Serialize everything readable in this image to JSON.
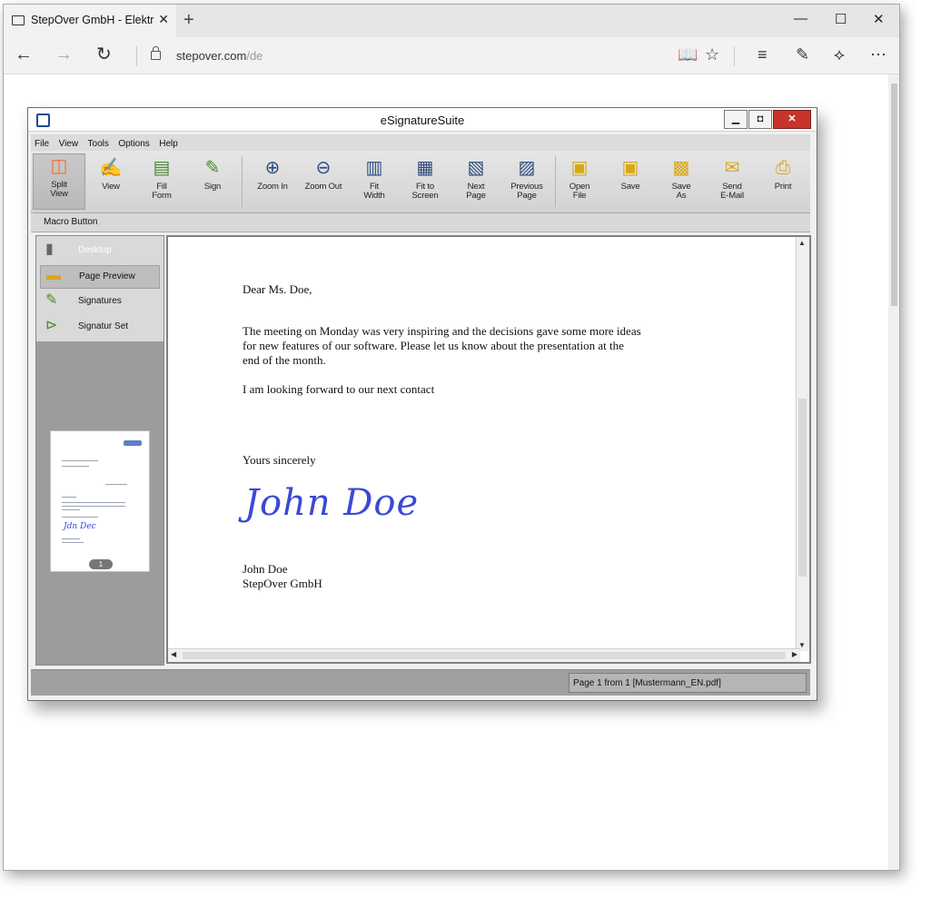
{
  "browser": {
    "tab_title": "StepOver GmbH - Elektr",
    "url_domain": "stepover.com",
    "url_path": "/de",
    "new_tab_symbol": "+"
  },
  "app": {
    "title": "eSignatureSuite",
    "menu": [
      "File",
      "View",
      "Tools",
      "Options",
      "Help"
    ],
    "toolbar": [
      {
        "label": "Split\nView",
        "icon": "split-view-icon",
        "color": "#e6743c"
      },
      {
        "label": "View",
        "icon": "view-icon",
        "color": "#4b8a2e"
      },
      {
        "label": "Fill\nForm",
        "icon": "fill-form-icon",
        "color": "#4b8a2e"
      },
      {
        "label": "Sign",
        "icon": "sign-pen-icon",
        "color": "#4b8a2e"
      },
      {
        "label": "Zoom In",
        "icon": "zoom-in-icon",
        "color": "#2e4c7e"
      },
      {
        "label": "Zoom Out",
        "icon": "zoom-out-icon",
        "color": "#2e4c7e"
      },
      {
        "label": "Fit\nWidth",
        "icon": "fit-width-icon",
        "color": "#2e4c7e"
      },
      {
        "label": "Fit to\nScreen",
        "icon": "fit-screen-icon",
        "color": "#2e4c7e"
      },
      {
        "label": "Next\nPage",
        "icon": "next-page-icon",
        "color": "#2e4c7e"
      },
      {
        "label": "Previous\nPage",
        "icon": "previous-page-icon",
        "color": "#2e4c7e"
      },
      {
        "label": "Open\nFile",
        "icon": "open-file-icon",
        "color": "#d8a814"
      },
      {
        "label": "Save",
        "icon": "save-icon",
        "color": "#d8a814"
      },
      {
        "label": "Save\nAs",
        "icon": "save-as-icon",
        "color": "#d8a814"
      },
      {
        "label": "Send\nE-Mail",
        "icon": "email-icon",
        "color": "#d8a814"
      },
      {
        "label": "Print",
        "icon": "print-icon",
        "color": "#d8a814"
      }
    ],
    "macro_label": "Macro Button",
    "side_items": [
      {
        "label": "Desktop",
        "state": "disabled"
      },
      {
        "label": "Page Preview",
        "state": "selected"
      },
      {
        "label": "Signatures",
        "state": "normal"
      },
      {
        "label": "Signatur Set",
        "state": "normal"
      }
    ],
    "thumbnail_page": "1",
    "letter": {
      "salutation": "Dear Ms. Doe,",
      "para1_line1": "The meeting on Monday was very inspiring and the decisions gave some more ideas",
      "para1_line2": "for new features of our software. Please let us know about the presentation at the",
      "para1_line3": "end of the month.",
      "para2": "I am looking forward to our next contact",
      "closing": "Yours sincerely",
      "signature": "John Doe",
      "name": "John Doe",
      "company": "StepOver GmbH"
    },
    "status": "Page 1 from 1  [Mustermann_EN.pdf]"
  }
}
